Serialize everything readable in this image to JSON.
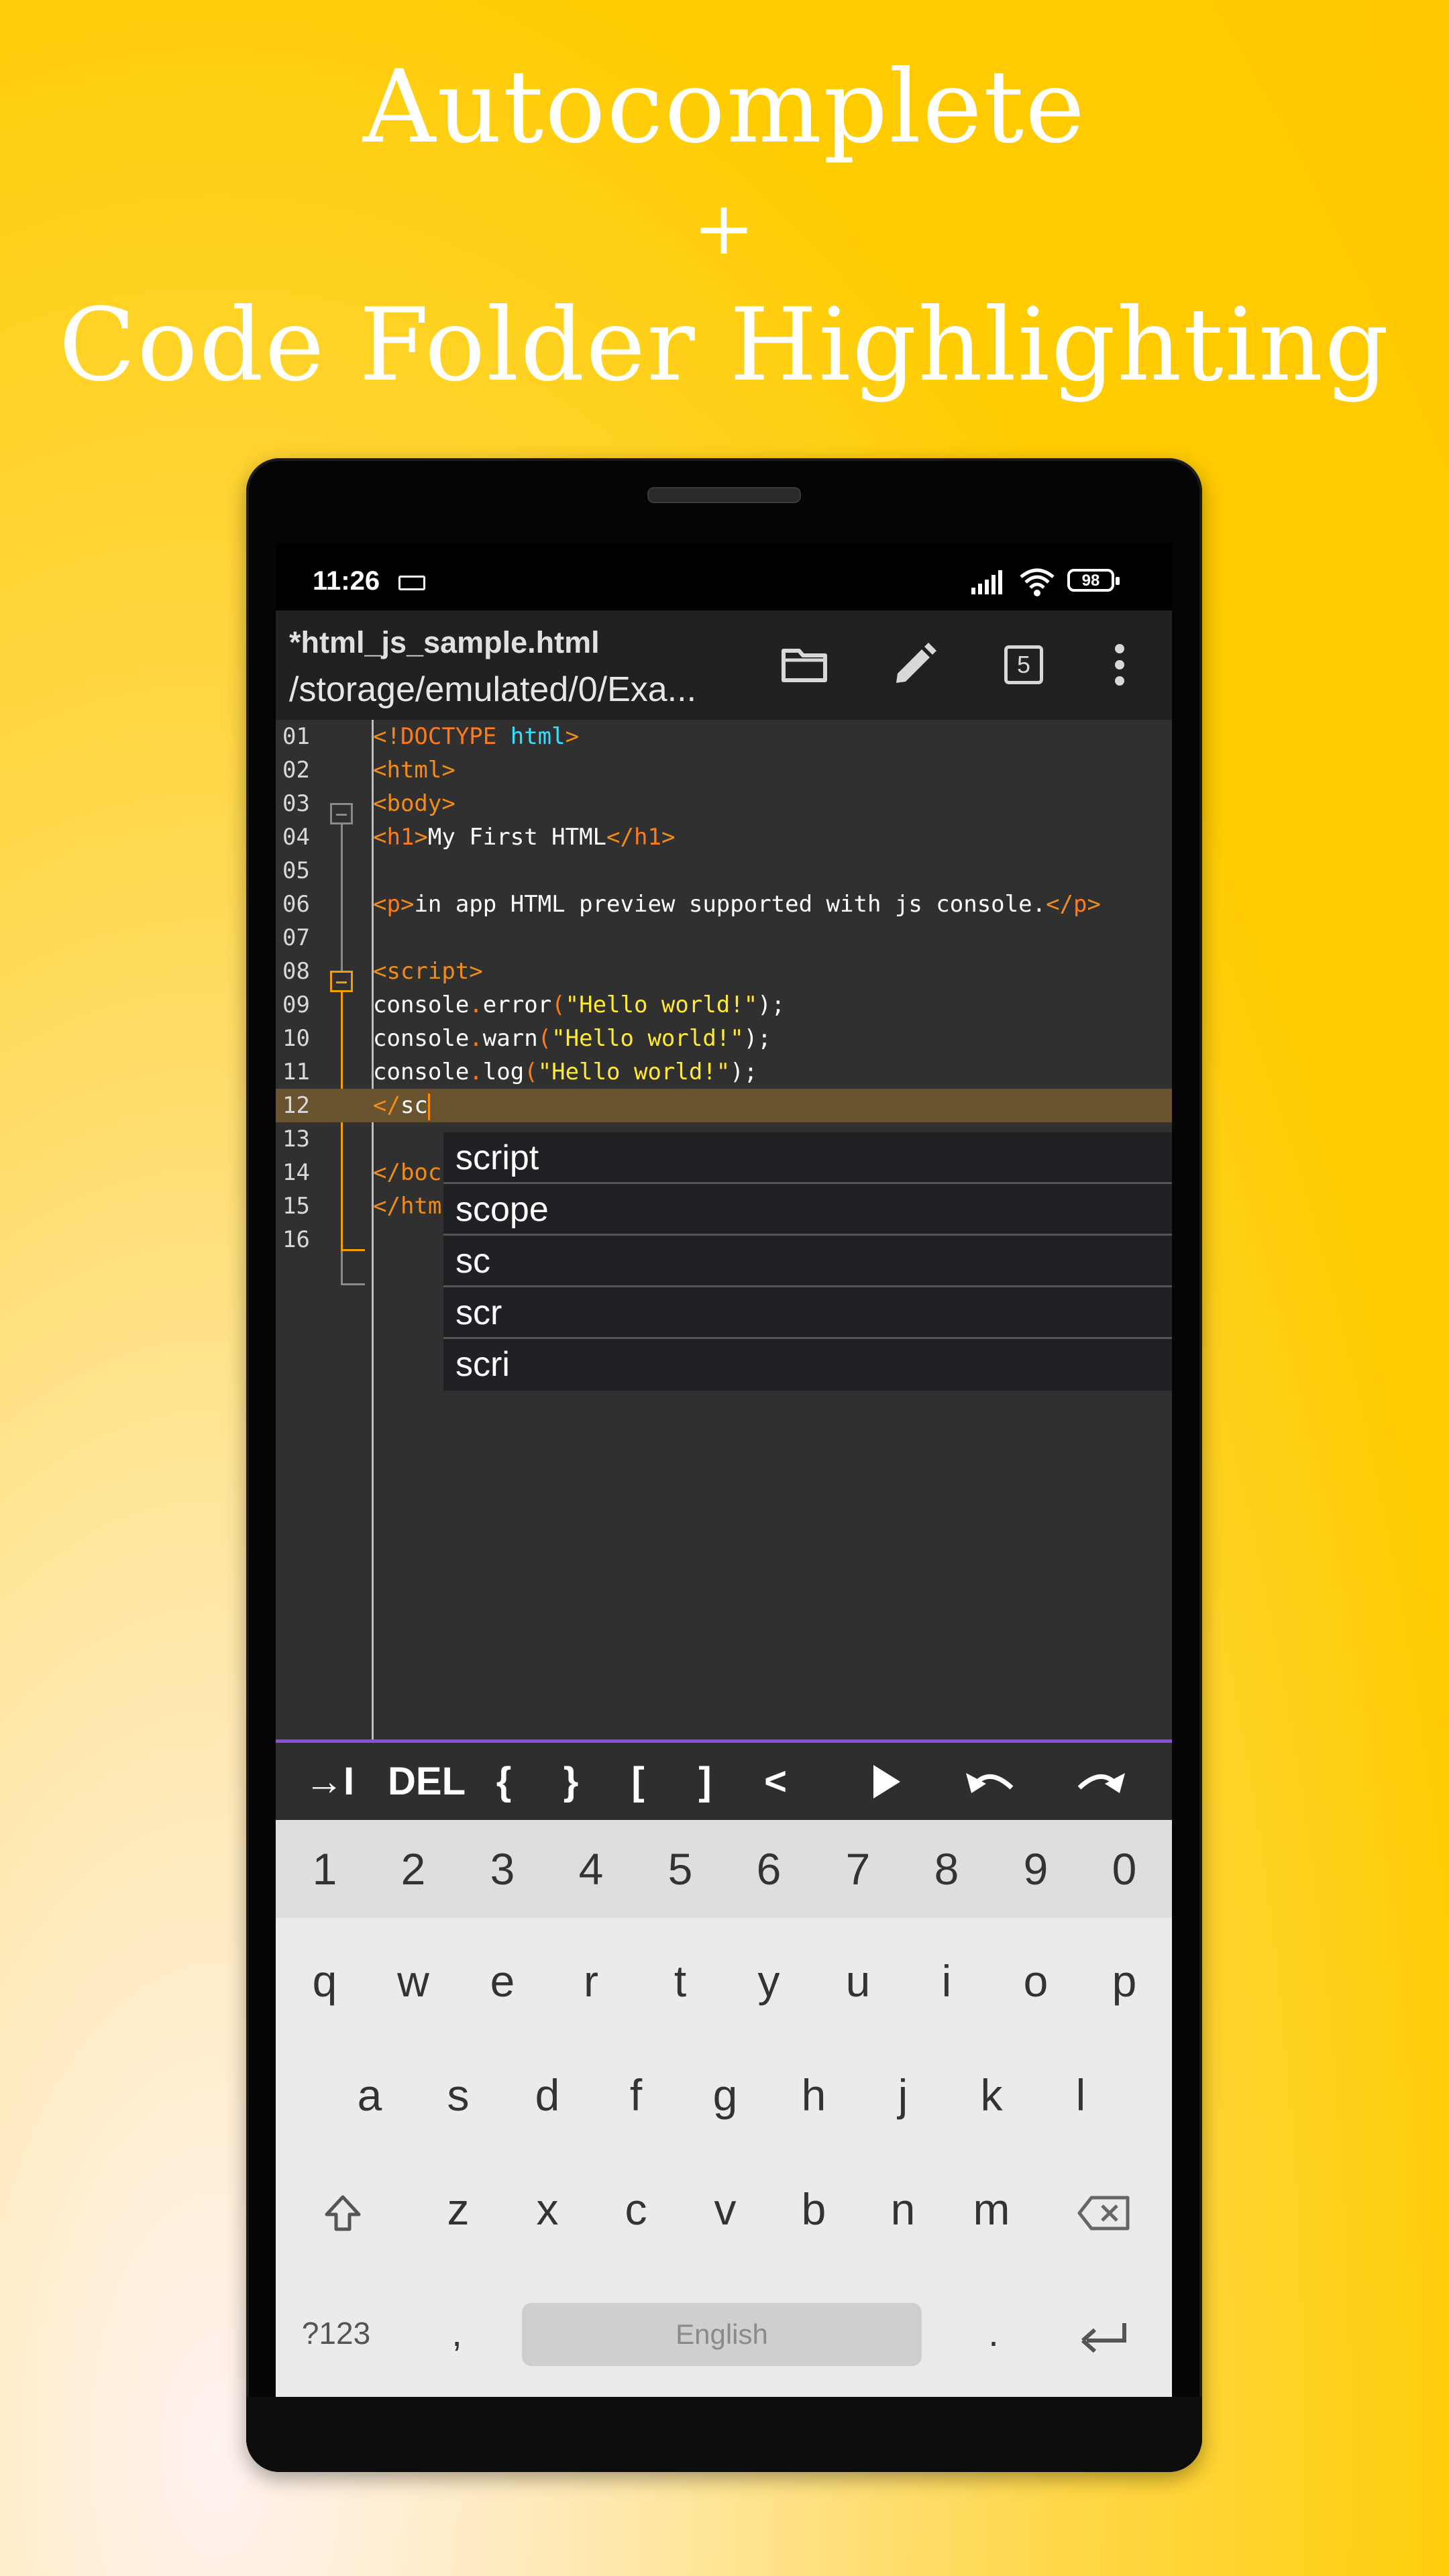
{
  "headline": {
    "line1": "Autocomplete",
    "line2": "+",
    "line3": "Code Folder Highlighting"
  },
  "status_bar": {
    "time": "11:26",
    "battery": "98"
  },
  "app_bar": {
    "file_name": "*html_js_sample.html",
    "file_path": "/storage/emulated/0/Exa...",
    "tab_count": "5"
  },
  "editor": {
    "line_numbers": [
      "01",
      "02",
      "03",
      "04",
      "05",
      "06",
      "07",
      "08",
      "09",
      "10",
      "11",
      "12",
      "13",
      "14",
      "15",
      "16"
    ],
    "current_line": "12",
    "code": {
      "l01_open": "<!",
      "l01_doctype": "DOCTYPE",
      "l01_html": "html",
      "l01_close": ">",
      "l02": "<html>",
      "l03": "<body>",
      "l04_open": "<",
      "l04_h1": "h1",
      "l04_gt": ">",
      "l04_text": "My First HTML",
      "l04_close_open": "</",
      "l04_close_h1": "h1",
      "l04_close_gt": ">",
      "l06_open": "<",
      "l06_p": "p",
      "l06_gt": ">",
      "l06_text": "in app HTML preview supported with js console.",
      "l06_close_open": "</",
      "l06_close_p": "p",
      "l06_close_gt": ">",
      "l08": "<script>",
      "l09_obj": "console",
      "l09_method": "error",
      "l09_paren": "(",
      "l09_str": "\"Hello world!\"",
      "l09_end": ");",
      "l10_obj": "console",
      "l10_method": "warn",
      "l10_str": "\"Hello world!\"",
      "l11_obj": "console",
      "l11_method": "log",
      "l11_str": "\"Hello world!\"",
      "l12_tag": "</",
      "l12_text": "sc",
      "l14_tag": "</",
      "l14_text": "boc",
      "l15_tag": "</",
      "l15_text": "htm"
    }
  },
  "autocomplete": [
    "script",
    "scope",
    "sc",
    "scr",
    "scri"
  ],
  "extra_keys": {
    "tab": "→I",
    "del": "DEL",
    "lbrace": "{",
    "rbrace": "}",
    "lbracket": "[",
    "rbracket": "]",
    "lt": "<"
  },
  "keyboard": {
    "numbers": [
      "1",
      "2",
      "3",
      "4",
      "5",
      "6",
      "7",
      "8",
      "9",
      "0"
    ],
    "row1": [
      "q",
      "w",
      "e",
      "r",
      "t",
      "y",
      "u",
      "i",
      "o",
      "p"
    ],
    "row2": [
      "a",
      "s",
      "d",
      "f",
      "g",
      "h",
      "j",
      "k",
      "l"
    ],
    "row3": [
      "z",
      "x",
      "c",
      "v",
      "b",
      "n",
      "m"
    ],
    "symbols": "?123",
    "comma": ",",
    "space": "English",
    "period": "."
  },
  "colors": {
    "background": "#ffcc00",
    "accent_purple": "#8a4ee0",
    "tag_orange": "#f28c18",
    "string_yellow": "#ffe933",
    "attr_cyan": "#38e0ff",
    "highlight_line": "#6a5430"
  }
}
